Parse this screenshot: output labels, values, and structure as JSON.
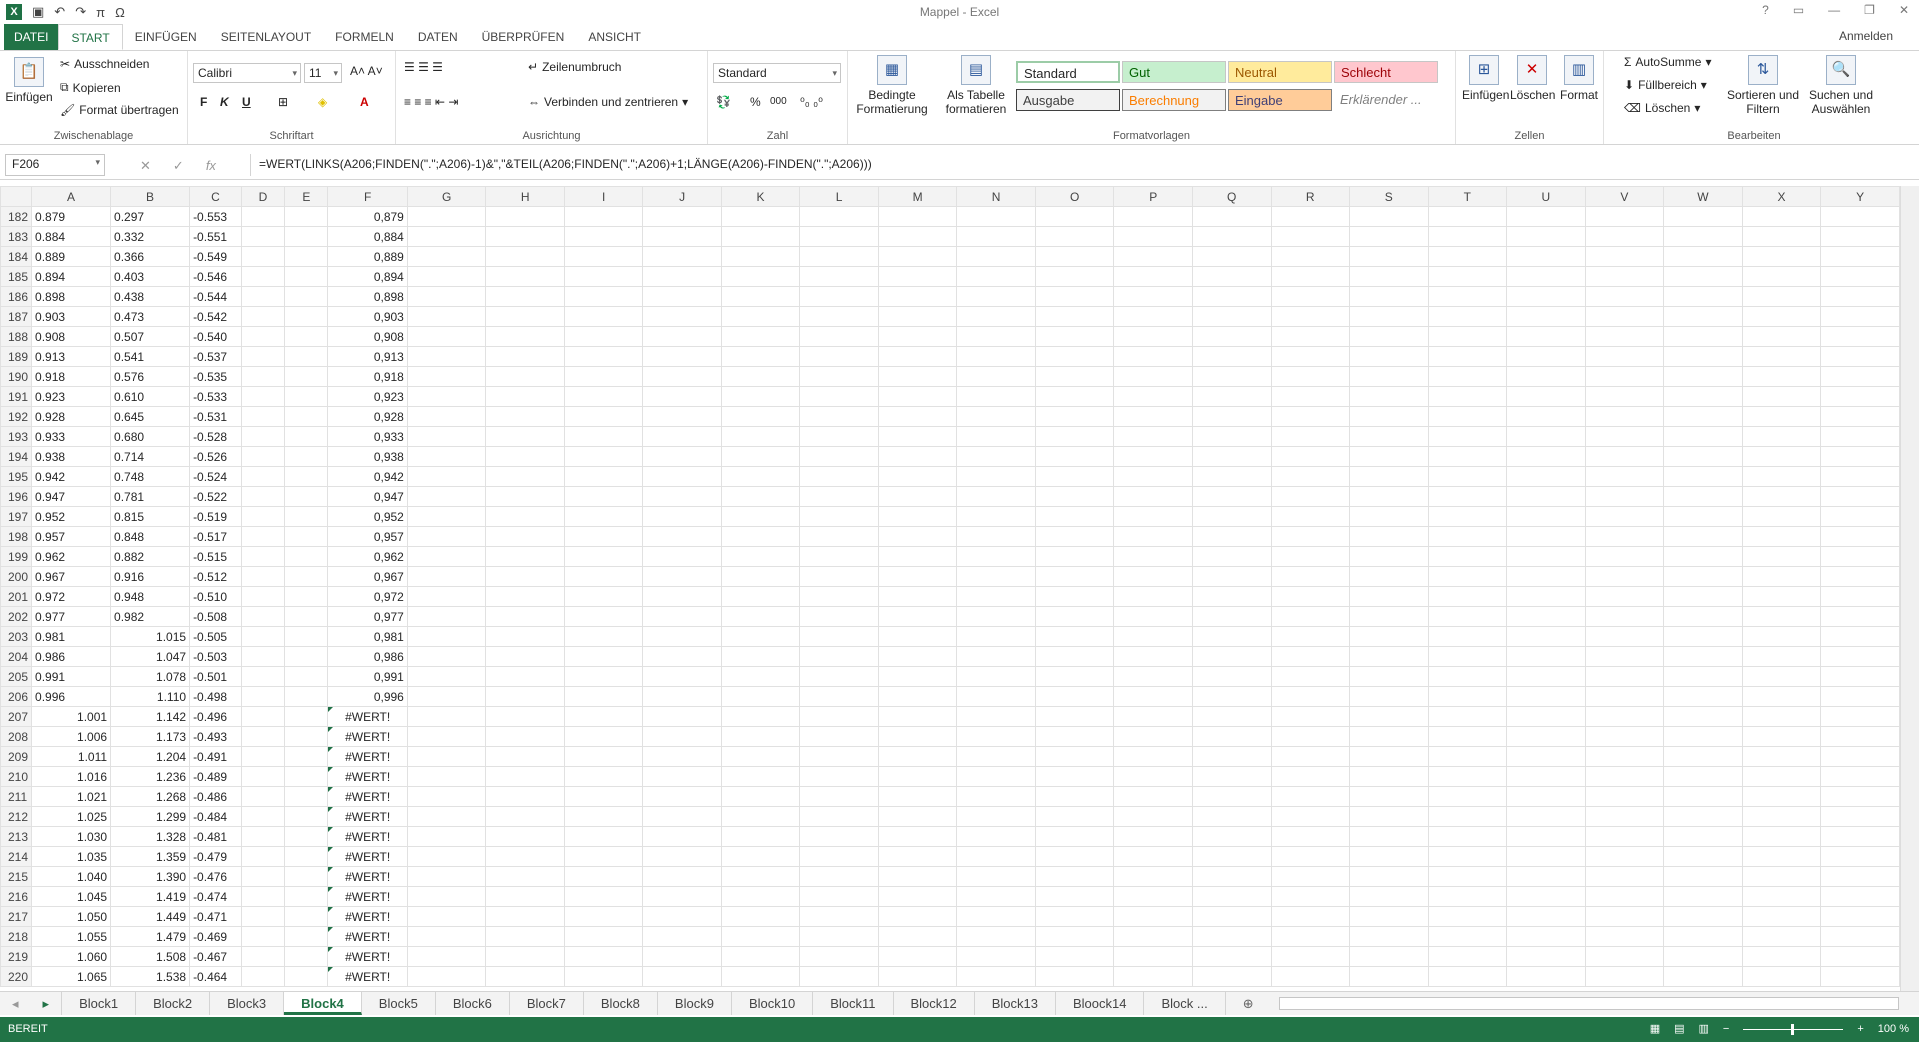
{
  "window": {
    "title": "Mappel - Excel",
    "signin": "Anmelden"
  },
  "qat": {
    "app_icon": "X",
    "undo": "↶",
    "redo": "↷",
    "pi": "π",
    "omega": "Ω"
  },
  "tabs": [
    "DATEI",
    "START",
    "EINFÜGEN",
    "SEITENLAYOUT",
    "FORMELN",
    "DATEN",
    "ÜBERPRÜFEN",
    "ANSICHT"
  ],
  "ribbon": {
    "clipboard": {
      "paste": "Einfügen",
      "cut": "Ausschneiden",
      "copy": "Kopieren",
      "painter": "Format übertragen",
      "label": "Zwischenablage"
    },
    "font": {
      "name": "Calibri",
      "size": "11",
      "label": "Schriftart",
      "bold": "F",
      "italic": "K",
      "underline": "U"
    },
    "align": {
      "wrap": "Zeilenumbruch",
      "merge": "Verbinden und zentrieren",
      "label": "Ausrichtung"
    },
    "number": {
      "format": "Standard",
      "label": "Zahl",
      "percent": "%",
      "thousands": "000"
    },
    "styles": {
      "cond": "Bedingte Formatierung",
      "table": "Als Tabelle formatieren",
      "label": "Formatvorlagen",
      "items": [
        "Standard",
        "Gut",
        "Neutral",
        "Schlecht",
        "Ausgabe",
        "Berechnung",
        "Eingabe",
        "Erklärender ..."
      ]
    },
    "cells": {
      "insert": "Einfügen",
      "delete": "Löschen",
      "format": "Format",
      "label": "Zellen"
    },
    "editing": {
      "autosum": "AutoSumme",
      "fill": "Füllbereich",
      "clear": "Löschen",
      "sort": "Sortieren und Filtern",
      "find": "Suchen und Auswählen",
      "label": "Bearbeiten"
    }
  },
  "formula_bar": {
    "name_box": "F206",
    "fx": "fx",
    "formula": "=WERT(LINKS(A206;FINDEN(\".\";A206)-1)&\",\"&TEIL(A206;FINDEN(\".\";A206)+1;LÄNGE(A206)-FINDEN(\".\";A206)))"
  },
  "columns": [
    "A",
    "B",
    "C",
    "D",
    "E",
    "F",
    "G",
    "H",
    "I",
    "J",
    "K",
    "L",
    "M",
    "N",
    "O",
    "P",
    "Q",
    "R",
    "S",
    "T",
    "U",
    "V",
    "W",
    "X",
    "Y"
  ],
  "rows": [
    [
      "182",
      "0.879",
      "0.297",
      "-0.553",
      "0,879"
    ],
    [
      "183",
      "0.884",
      "0.332",
      "-0.551",
      "0,884"
    ],
    [
      "184",
      "0.889",
      "0.366",
      "-0.549",
      "0,889"
    ],
    [
      "185",
      "0.894",
      "0.403",
      "-0.546",
      "0,894"
    ],
    [
      "186",
      "0.898",
      "0.438",
      "-0.544",
      "0,898"
    ],
    [
      "187",
      "0.903",
      "0.473",
      "-0.542",
      "0,903"
    ],
    [
      "188",
      "0.908",
      "0.507",
      "-0.540",
      "0,908"
    ],
    [
      "189",
      "0.913",
      "0.541",
      "-0.537",
      "0,913"
    ],
    [
      "190",
      "0.918",
      "0.576",
      "-0.535",
      "0,918"
    ],
    [
      "191",
      "0.923",
      "0.610",
      "-0.533",
      "0,923"
    ],
    [
      "192",
      "0.928",
      "0.645",
      "-0.531",
      "0,928"
    ],
    [
      "193",
      "0.933",
      "0.680",
      "-0.528",
      "0,933"
    ],
    [
      "194",
      "0.938",
      "0.714",
      "-0.526",
      "0,938"
    ],
    [
      "195",
      "0.942",
      "0.748",
      "-0.524",
      "0,942"
    ],
    [
      "196",
      "0.947",
      "0.781",
      "-0.522",
      "0,947"
    ],
    [
      "197",
      "0.952",
      "0.815",
      "-0.519",
      "0,952"
    ],
    [
      "198",
      "0.957",
      "0.848",
      "-0.517",
      "0,957"
    ],
    [
      "199",
      "0.962",
      "0.882",
      "-0.515",
      "0,962"
    ],
    [
      "200",
      "0.967",
      "0.916",
      "-0.512",
      "0,967"
    ],
    [
      "201",
      "0.972",
      "0.948",
      "-0.510",
      "0,972"
    ],
    [
      "202",
      "0.977",
      "0.982",
      "-0.508",
      "0,977"
    ],
    [
      "203",
      "0.981",
      "1.015",
      "-0.505",
      "0,981"
    ],
    [
      "204",
      "0.986",
      "1.047",
      "-0.503",
      "0,986"
    ],
    [
      "205",
      "0.991",
      "1.078",
      "-0.501",
      "0,991"
    ],
    [
      "206",
      "0.996",
      "1.110",
      "-0.498",
      "0,996"
    ],
    [
      "207",
      "1.001",
      "1.142",
      "-0.496",
      "#WERT!"
    ],
    [
      "208",
      "1.006",
      "1.173",
      "-0.493",
      "#WERT!"
    ],
    [
      "209",
      "1.011",
      "1.204",
      "-0.491",
      "#WERT!"
    ],
    [
      "210",
      "1.016",
      "1.236",
      "-0.489",
      "#WERT!"
    ],
    [
      "211",
      "1.021",
      "1.268",
      "-0.486",
      "#WERT!"
    ],
    [
      "212",
      "1.025",
      "1.299",
      "-0.484",
      "#WERT!"
    ],
    [
      "213",
      "1.030",
      "1.328",
      "-0.481",
      "#WERT!"
    ],
    [
      "214",
      "1.035",
      "1.359",
      "-0.479",
      "#WERT!"
    ],
    [
      "215",
      "1.040",
      "1.390",
      "-0.476",
      "#WERT!"
    ],
    [
      "216",
      "1.045",
      "1.419",
      "-0.474",
      "#WERT!"
    ],
    [
      "217",
      "1.050",
      "1.449",
      "-0.471",
      "#WERT!"
    ],
    [
      "218",
      "1.055",
      "1.479",
      "-0.469",
      "#WERT!"
    ],
    [
      "219",
      "1.060",
      "1.508",
      "-0.467",
      "#WERT!"
    ],
    [
      "220",
      "1.065",
      "1.538",
      "-0.464",
      "#WERT!"
    ]
  ],
  "sheets": [
    "Block1",
    "Block2",
    "Block3",
    "Block4",
    "Block5",
    "Block6",
    "Block7",
    "Block8",
    "Block9",
    "Block10",
    "Block11",
    "Block12",
    "Block13",
    "Bloock14",
    "Block ..."
  ],
  "active_sheet": "Block4",
  "status": {
    "text": "BEREIT",
    "zoom": "100 %"
  }
}
